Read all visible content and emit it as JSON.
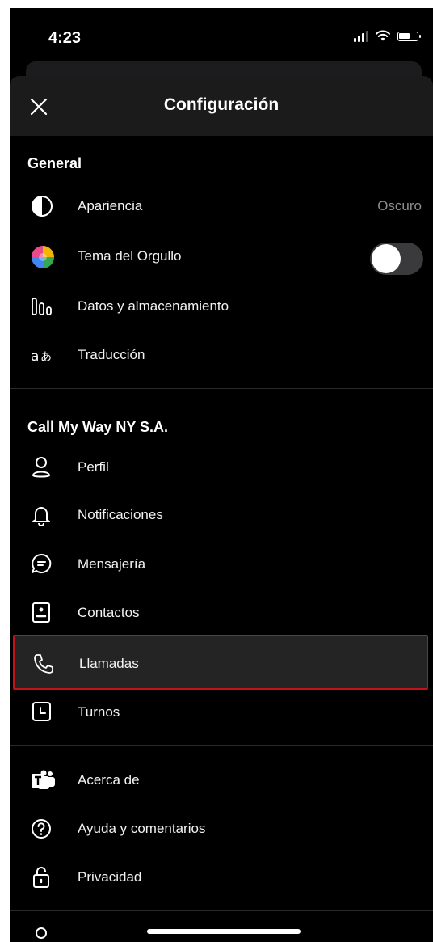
{
  "status": {
    "time": "4:23"
  },
  "header": {
    "title": "Configuración"
  },
  "general": {
    "title": "General",
    "items": [
      {
        "label": "Apariencia",
        "value": "Oscuro",
        "icon": "appearance-icon"
      },
      {
        "label": "Tema del Orgullo",
        "toggle": false,
        "icon": "pride-icon"
      },
      {
        "label": "Datos y almacenamiento",
        "icon": "data-storage-icon"
      },
      {
        "label": "Traducción",
        "icon": "translation-icon"
      }
    ]
  },
  "org": {
    "title": "Call My Way NY S.A.",
    "items": [
      {
        "label": "Perfil",
        "icon": "profile-icon"
      },
      {
        "label": "Notificaciones",
        "icon": "bell-icon"
      },
      {
        "label": "Mensajería",
        "icon": "chat-icon"
      },
      {
        "label": "Contactos",
        "icon": "contact-card-icon"
      },
      {
        "label": "Llamadas",
        "icon": "phone-icon",
        "highlighted": true
      },
      {
        "label": "Turnos",
        "icon": "shifts-icon"
      }
    ]
  },
  "other": {
    "items": [
      {
        "label": "Acerca de",
        "icon": "teams-icon"
      },
      {
        "label": "Ayuda y comentarios",
        "icon": "help-icon"
      },
      {
        "label": "Privacidad",
        "icon": "lock-icon"
      }
    ]
  },
  "colors": {
    "background": "#000000",
    "highlight_border": "#c4121a",
    "secondary_text": "#8d8d8d"
  }
}
